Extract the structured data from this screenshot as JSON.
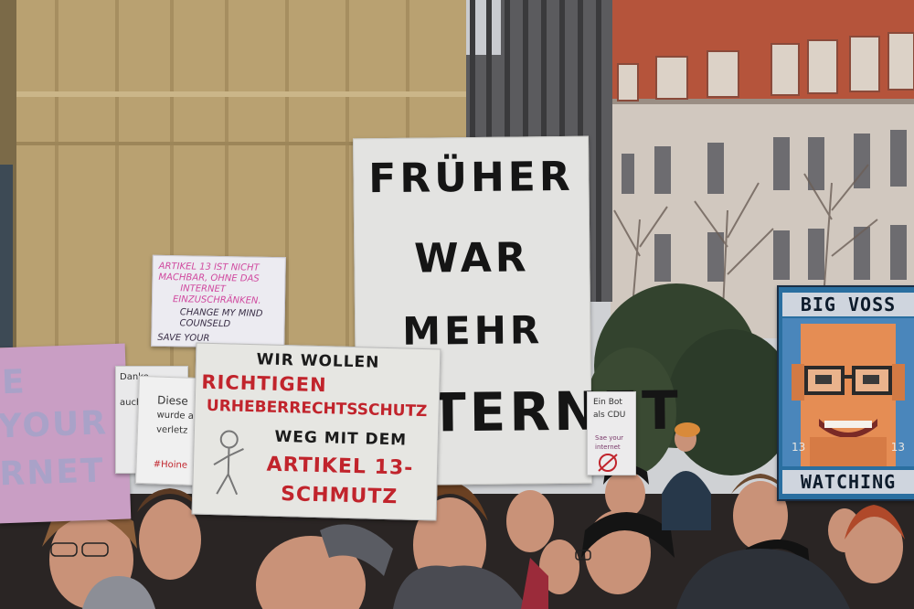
{
  "scene": {
    "colors": {
      "sky": "#d9dadd",
      "gold_wall": "#b79f6e",
      "gold_wall_dark": "#8f7a52",
      "glass_building": "#4e4e4f",
      "roof": "#b5543b",
      "facade": "#d1c8bf",
      "tree": "#3b4a33",
      "crowd_dark": "#2a2524",
      "skin": "#c99278"
    }
  },
  "signs": {
    "main": {
      "lines": [
        "FRÜHER",
        "WAR",
        "MEHR",
        "TERNET"
      ],
      "text_color": "#151515"
    },
    "urheberrecht": {
      "lines": [
        "WIR WOLLEN",
        "RICHTIGEN",
        "URHEBERRECHTSSCHUTZ",
        "WEG MIT DEM",
        "ARTIKEL 13-",
        "SCHMUTZ"
      ],
      "colors": {
        "black": "#1b1b1b",
        "red": "#c1242c"
      }
    },
    "pink_note": {
      "lines": [
        "ARTIKEL 13 IST NICHT",
        "MACHBAR, OHNE DAS",
        "INTERNET",
        "EINZUSCHRÄNKEN.",
        "CHANGE MY MIND",
        "COUNSELD",
        "SAVE YOUR"
      ],
      "colors": {
        "pink": "#d0499f",
        "dark": "#3a2f47"
      }
    },
    "left_violet": {
      "lines": [
        "E",
        "YOUR",
        "RNET"
      ]
    },
    "danke": {
      "lines": [
        "Danke",
        "auch"
      ]
    },
    "diese": {
      "lines": [
        "Diese",
        "wurde a",
        "verletz",
        "#Hoine"
      ]
    },
    "bot": {
      "lines": [
        "Ein Bot",
        "als CDU",
        "Sae your",
        "internet"
      ]
    },
    "voss": {
      "top": "BIG VOSS",
      "bottom": "WATCHING",
      "number_left": "13",
      "number_right": "13"
    }
  }
}
